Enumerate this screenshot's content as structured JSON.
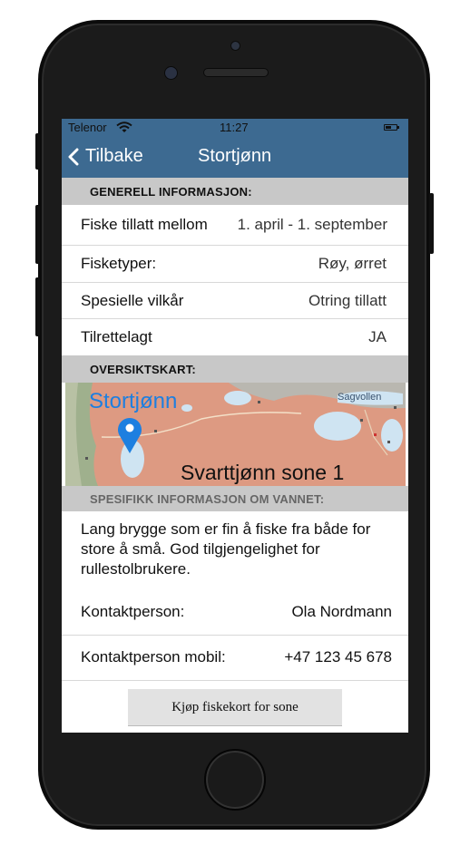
{
  "status": {
    "carrier": "Telenor",
    "time": "11:27",
    "icon_wifi": "wifi-icon",
    "icon_battery": "battery-icon"
  },
  "nav": {
    "back_label": "Tilbake",
    "title": "Stortjønn",
    "icon_back": "chevron-left-icon"
  },
  "general": {
    "header": "GENERELL INFORMASJON:",
    "rows": [
      {
        "label": "Fiske tillatt mellom",
        "value": "1. april - 1. september"
      },
      {
        "label": "Fisketyper:",
        "value": "Røy, ørret"
      },
      {
        "label": "Spesielle vilkår",
        "value": "Otring tillatt"
      },
      {
        "label": "Tilrettelagt",
        "value": "JA"
      }
    ]
  },
  "overview": {
    "header": "OVERSIKTSKART:",
    "map_label_lake": "Stortjønn",
    "map_label_zone": "Svarttjønn sone 1",
    "map_label_place": "Sagvollen",
    "icon_pin": "map-pin-icon"
  },
  "specific": {
    "header": "SPESIFIKK INFORMASJON OM VANNET:",
    "description": "Lang brygge som er fin å fiske fra både for store å små. God tilgjengelighet for rullestolbrukere.",
    "contact_label": "Kontaktperson:",
    "contact_value": "Ola Nordmann",
    "mobile_label": "Kontaktperson mobil:",
    "mobile_value": "+47 123 45 678"
  },
  "buy_button": "Kjøp fiskekort for sone",
  "colors": {
    "nav": "#3d6a91",
    "section": "#c8c8c8",
    "pin": "#1d7fe0",
    "map": "#dd9a82"
  }
}
